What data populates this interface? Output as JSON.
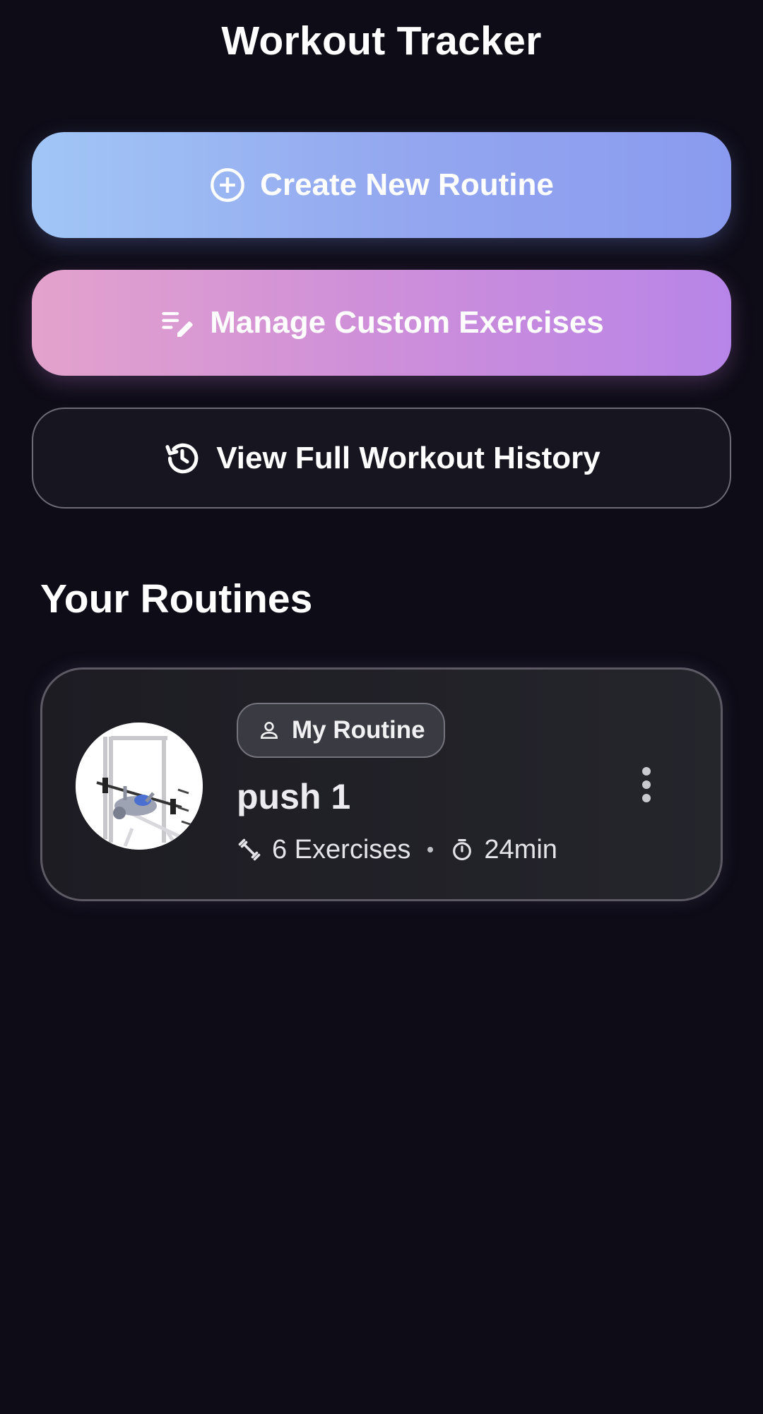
{
  "header": {
    "title": "Workout Tracker"
  },
  "actions": {
    "create_label": "Create New Routine",
    "manage_label": "Manage Custom Exercises",
    "history_label": "View Full Workout History"
  },
  "routines_section": {
    "title": "Your Routines",
    "items": [
      {
        "badge": "My Routine",
        "name": "push 1",
        "exercises": "6 Exercises",
        "duration": "24min",
        "thumbnail_icon": "bench-press-image"
      }
    ]
  },
  "icons": {
    "create": "add-circle-icon",
    "manage": "edit-list-icon",
    "history": "history-icon",
    "badge": "person-icon",
    "exercises": "dumbbell-icon",
    "duration": "timer-icon",
    "more": "more-vert-icon"
  },
  "colors": {
    "background": "#0e0c17",
    "create_gradient": [
      "#a1c6f6",
      "#8a9bef"
    ],
    "manage_gradient": [
      "#e3a2cc",
      "#b785e8"
    ],
    "card_background": "#1d1c23",
    "card_border": "#5d5a64"
  }
}
